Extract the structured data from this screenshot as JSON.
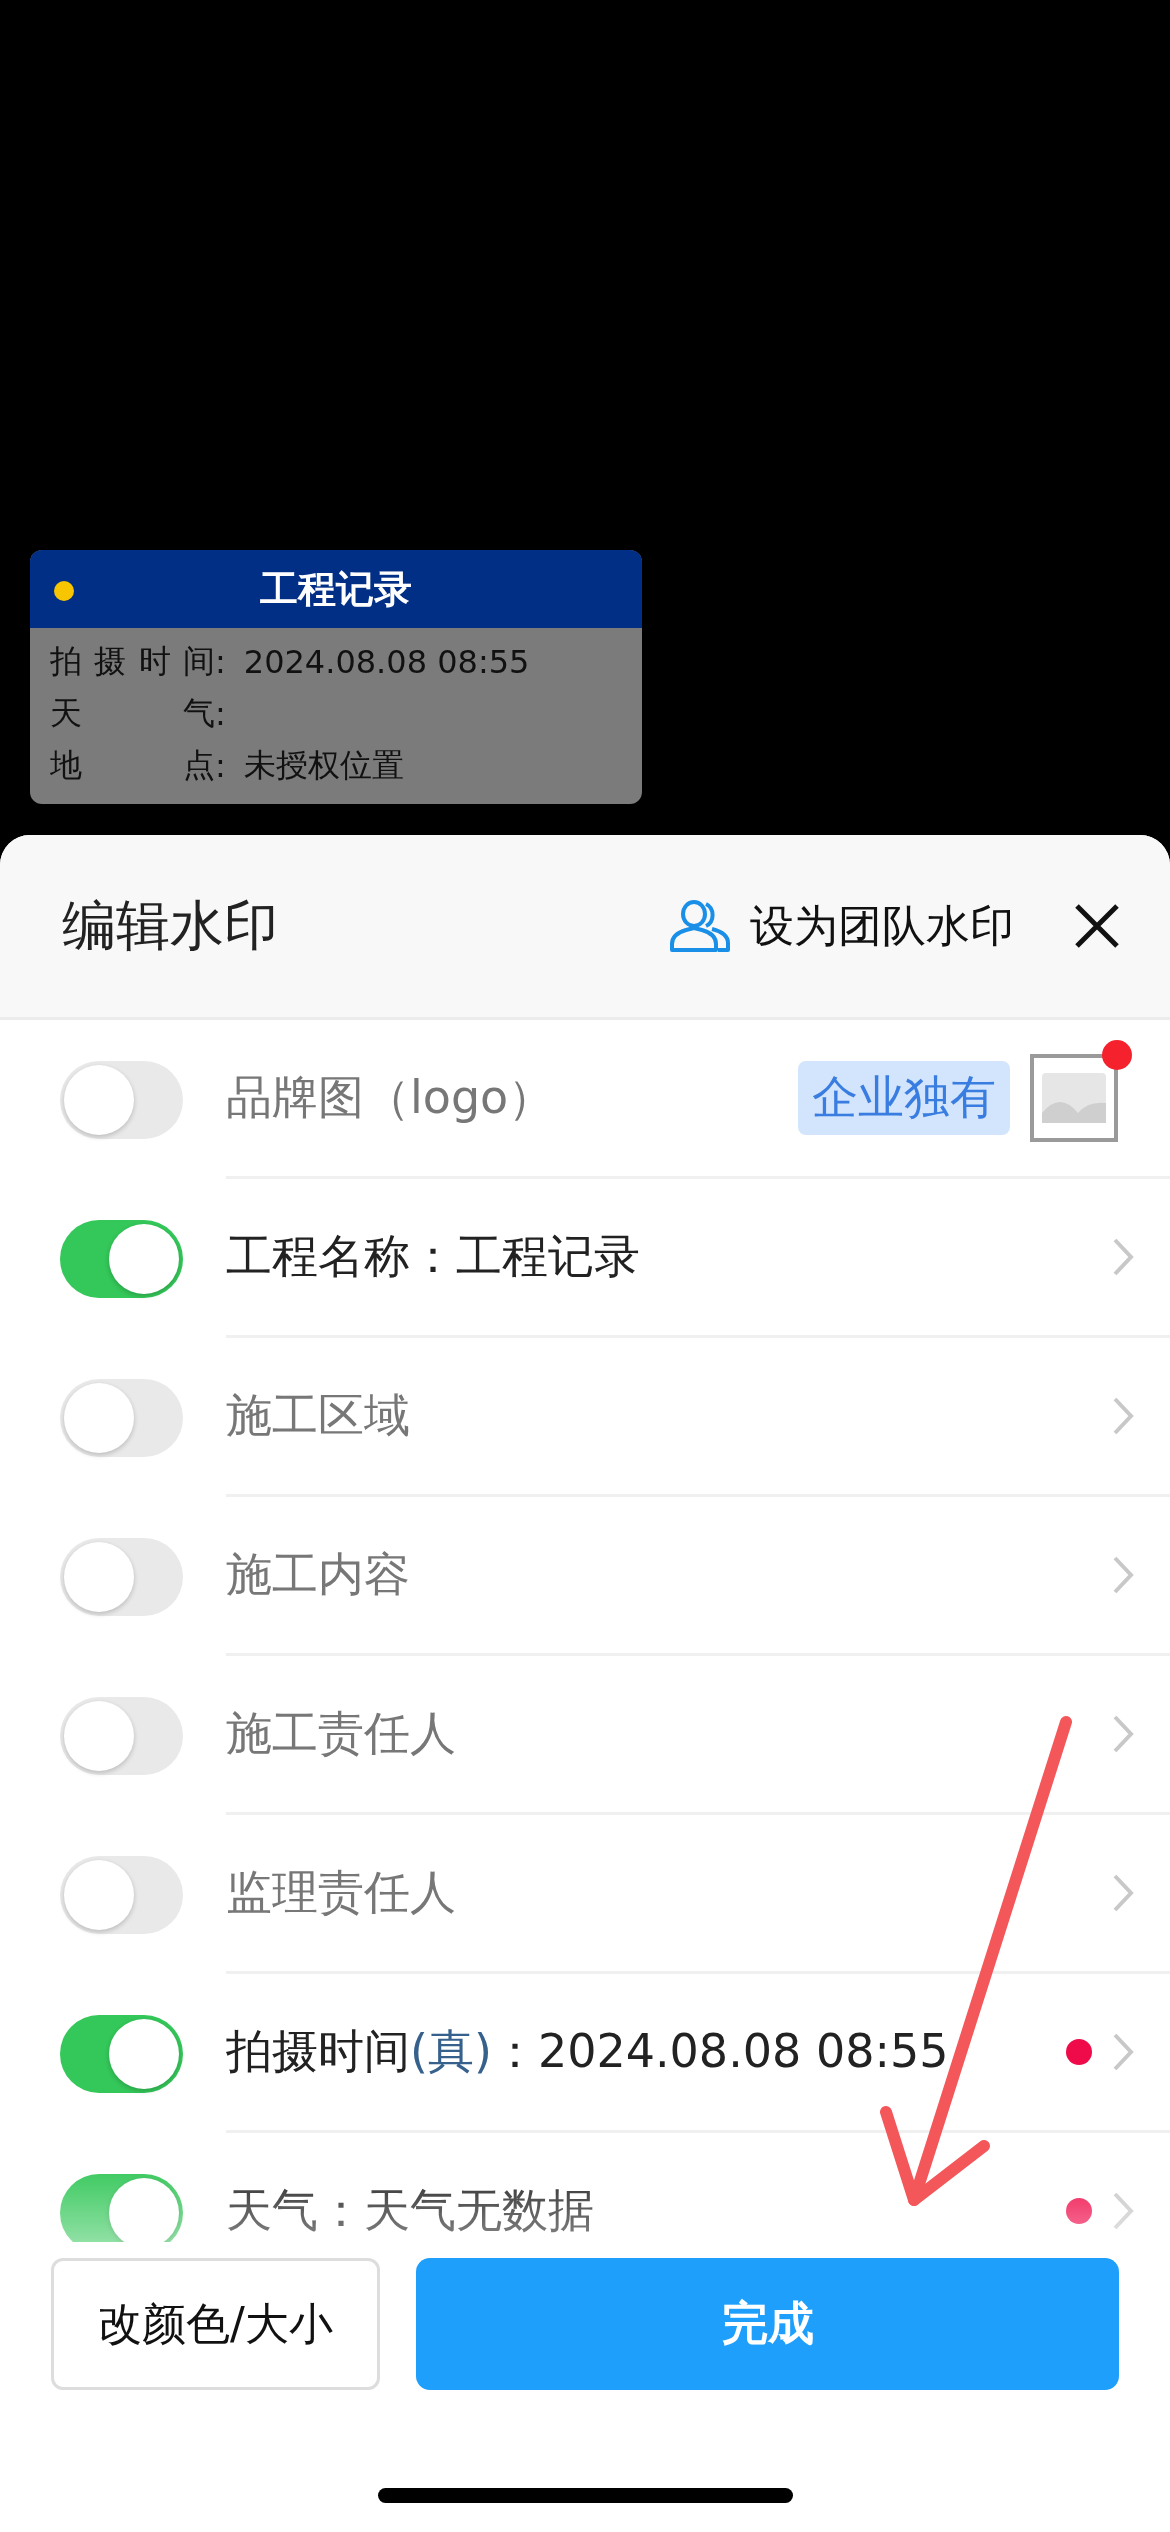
{
  "watermark": {
    "title": "工程记录",
    "rows": [
      {
        "label": "拍摄时间",
        "sep": ":",
        "value": "2024.08.08 08:55"
      },
      {
        "label": "天气",
        "sep": ":"
      },
      {
        "label": "地点",
        "sep": ":",
        "value": "未授权位置"
      }
    ]
  },
  "sheet": {
    "title": "编辑水印",
    "team_button": "设为团队水印",
    "rows": [
      {
        "kind": "brand",
        "on": false,
        "label": "品牌图（logo）",
        "badge": "企业独有"
      },
      {
        "kind": "field",
        "on": true,
        "label": "工程名称：工程记录"
      },
      {
        "kind": "field",
        "on": false,
        "label": "施工区域"
      },
      {
        "kind": "field",
        "on": false,
        "label": "施工内容"
      },
      {
        "kind": "field",
        "on": false,
        "label": "施工责任人"
      },
      {
        "kind": "field",
        "on": false,
        "label": "监理责任人"
      },
      {
        "kind": "field",
        "on": true,
        "label": "拍摄时间",
        "tag": "(真)",
        "rest": "：2024.08.08 08:55",
        "dot": true
      },
      {
        "kind": "field",
        "on": true,
        "label": "天气：天气无数据",
        "dot": true
      }
    ],
    "buttons": {
      "style": "改颜色/大小",
      "done": "完成"
    }
  }
}
